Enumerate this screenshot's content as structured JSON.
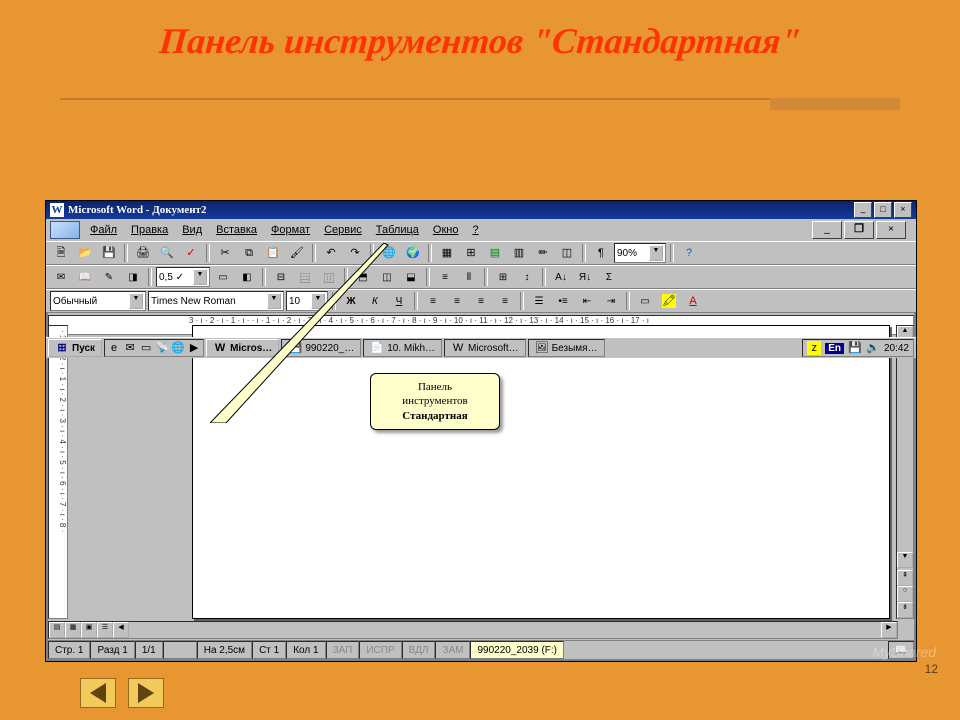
{
  "slide": {
    "title": "Панель инструментов \"Стандартная\"",
    "pageNumber": "12",
    "watermark": "MyShared"
  },
  "word": {
    "title": "Microsoft Word - Документ2",
    "menu": [
      "Файл",
      "Правка",
      "Вид",
      "Вставка",
      "Формат",
      "Сервис",
      "Таблица",
      "Окно",
      "?"
    ],
    "style": "Обычный",
    "font": "Times New Roman",
    "fontsize": "10",
    "zoom": "90%",
    "lineSpacing": "0,5 ✓",
    "rulerH": "3 · ı · 2 · ı · 1 · ı ·  · ı · 1 · ı · 2 · ı · 3 · ı · 4 · ı · 5 · ı · 6 · ı · 7 · ı · 8 · ı · 9 · ı · 10 · ı · 11 · ı · 12 · ı · 13 · ı · 14 · ı · 15 · ı · 16 · ı · 17 · ı",
    "rulerV": "· 1 · ı · 2 · ı · 1 · ı · 2 · ı · 3 · ı · 4 · ı · 5 · ı · 6 · ı · 7 · ı · 8 ·",
    "status": {
      "page": "Стр. 1",
      "section": "Разд 1",
      "pages": "1/1",
      "at": "На 2,5см",
      "line": "Ст 1",
      "col": "Кол 1",
      "rec": "ЗАП",
      "trk": "ИСПР",
      "ext": "ВДЛ",
      "ovr": "ЗАМ",
      "disk": "990220_2039 (F:)"
    },
    "formatButtons": {
      "b": "Ж",
      "i": "К",
      "u": "Ч"
    }
  },
  "callout": {
    "line1": "Панель",
    "line2": "инструментов",
    "line3": "Стандартная"
  },
  "taskbar": {
    "start": "Пуск",
    "tasks": [
      "Micros…",
      "990220_…",
      "10. Mikh…",
      "Microsoft…",
      "Безымя…"
    ],
    "lang": "En",
    "clock": "20:42"
  }
}
